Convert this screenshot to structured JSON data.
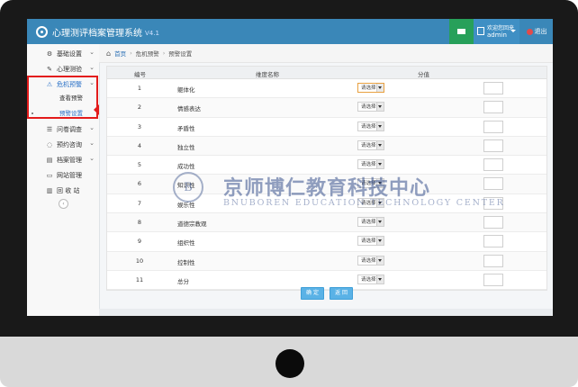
{
  "app": {
    "title": "心理测评档案管理系统",
    "version": "V4.1"
  },
  "topbar": {
    "welcome": "欢迎您回来",
    "username": "admin",
    "exit_label": "退出",
    "mail_icon": "envelope-icon"
  },
  "sidebar": {
    "items": [
      {
        "label": "基础设置",
        "icon": "gear-icon"
      },
      {
        "label": "心理测验",
        "icon": "edit-icon"
      },
      {
        "label": "危机预警",
        "icon": "warning-icon"
      },
      {
        "label": "问卷调查",
        "icon": "list-icon"
      },
      {
        "label": "预约咨询",
        "icon": "chat-icon"
      },
      {
        "label": "档案管理",
        "icon": "folder-icon"
      },
      {
        "label": "网站管理",
        "icon": "monitor-icon"
      },
      {
        "label": "回 收 站",
        "icon": "trash-icon"
      }
    ],
    "sub_items": [
      {
        "label": "查看预警"
      },
      {
        "label": "预警设置"
      }
    ]
  },
  "breadcrumb": {
    "home": "首页",
    "parent": "危机预警",
    "current": "预警设置"
  },
  "table": {
    "headers": [
      "编号",
      "维度名称",
      "分值"
    ],
    "select_placeholder": "请选择",
    "rows": [
      {
        "no": "1",
        "name": "躯体化"
      },
      {
        "no": "2",
        "name": "情感表达"
      },
      {
        "no": "3",
        "name": "矛盾性"
      },
      {
        "no": "4",
        "name": "独立性"
      },
      {
        "no": "5",
        "name": "成功性"
      },
      {
        "no": "6",
        "name": "知识性"
      },
      {
        "no": "7",
        "name": "娱乐性"
      },
      {
        "no": "8",
        "name": "道德宗教观"
      },
      {
        "no": "9",
        "name": "组织性"
      },
      {
        "no": "10",
        "name": "控制性"
      },
      {
        "no": "11",
        "name": "总分"
      }
    ]
  },
  "buttons": {
    "confirm": "确 定",
    "back": "返 回"
  },
  "watermark": {
    "logo_letter": "B",
    "cn": "京师博仁教育科技中心",
    "en": "BNUBOREN EDUCATION TECHNOLOGY CENTER"
  }
}
